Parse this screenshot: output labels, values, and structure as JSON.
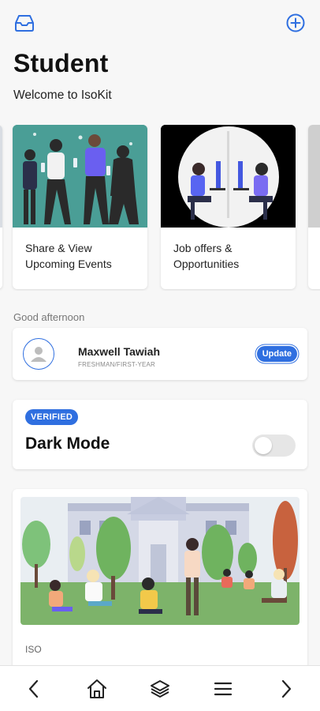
{
  "header": {
    "title": "Student",
    "subtitle": "Welcome to IsoKit",
    "inbox_icon": "inbox-tray-icon",
    "add_icon": "plus-circle-icon"
  },
  "carousel": {
    "cards": [
      {
        "label_line1": "Share & View",
        "label_line2": "Upcoming Events"
      },
      {
        "label_line1": "Job offers &",
        "label_line2": "Opportunities"
      }
    ]
  },
  "greeting": "Good afternoon",
  "profile": {
    "name": "Maxwell Tawiah",
    "role": "FRESHMAN/FIRST-YEAR",
    "update_label": "Update",
    "avatar_icon": "user-icon"
  },
  "dark_mode": {
    "badge": "VERIFIED",
    "title": "Dark Mode",
    "enabled": false
  },
  "feature": {
    "tag": "ISO"
  },
  "bottom_nav": {
    "items": [
      "chevron-left-icon",
      "home-icon",
      "layers-icon",
      "menu-icon",
      "chevron-right-icon"
    ]
  },
  "colors": {
    "accent": "#2f6fe0",
    "background": "#f7f7f7"
  }
}
